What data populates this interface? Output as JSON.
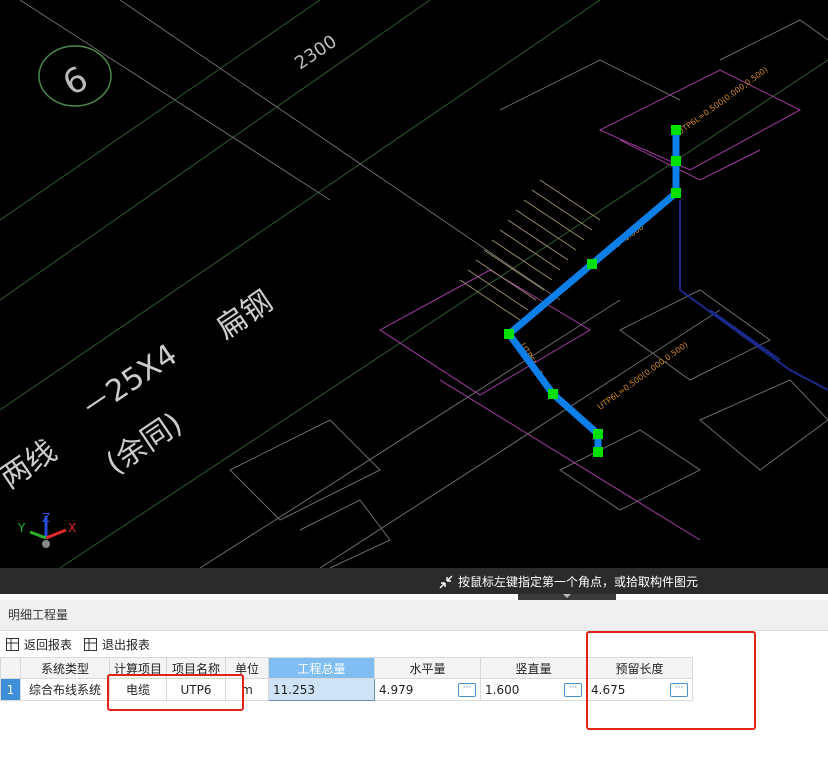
{
  "cad": {
    "axis_number": "6",
    "dimension_text": "2300",
    "label_flat_steel": "扁钢",
    "label_spec": "－25X4",
    "label_same": "(余同)",
    "label_line": "两线",
    "axis_labels": {
      "x": "X",
      "y": "Y",
      "z": "Z"
    },
    "cable_labels": [
      "UTP6L=0.500(0.000,0.500)",
      "UTP6L=1.860",
      "UTP6L=1.580",
      "UTP6L=0.500(0.000,0.500)"
    ],
    "cable_color": "#0d7fe8",
    "node_color": "#00e000"
  },
  "status": {
    "hint": "按鼠标左键指定第一个角点，或拾取构件图元"
  },
  "panel": {
    "title": "明细工程量",
    "toolbar": {
      "back_label": "返回报表",
      "exit_label": "退出报表"
    },
    "columns": [
      "系统类型",
      "计算项目",
      "项目名称",
      "单位",
      "工程总量",
      "水平量",
      "竖直量",
      "预留长度"
    ],
    "rows": [
      {
        "index": "1",
        "system_type": "综合布线系统",
        "calc_item": "电缆",
        "item_name": "UTP6",
        "unit": "m",
        "total": "11.253",
        "horizontal": "4.979",
        "vertical": "1.600",
        "reserved": "4.675"
      }
    ],
    "ellipsis": "···"
  },
  "colors": {
    "active_header": "#7fbdf2",
    "row_index": "#3f8fd8",
    "highlight_box": "#e2231a"
  }
}
